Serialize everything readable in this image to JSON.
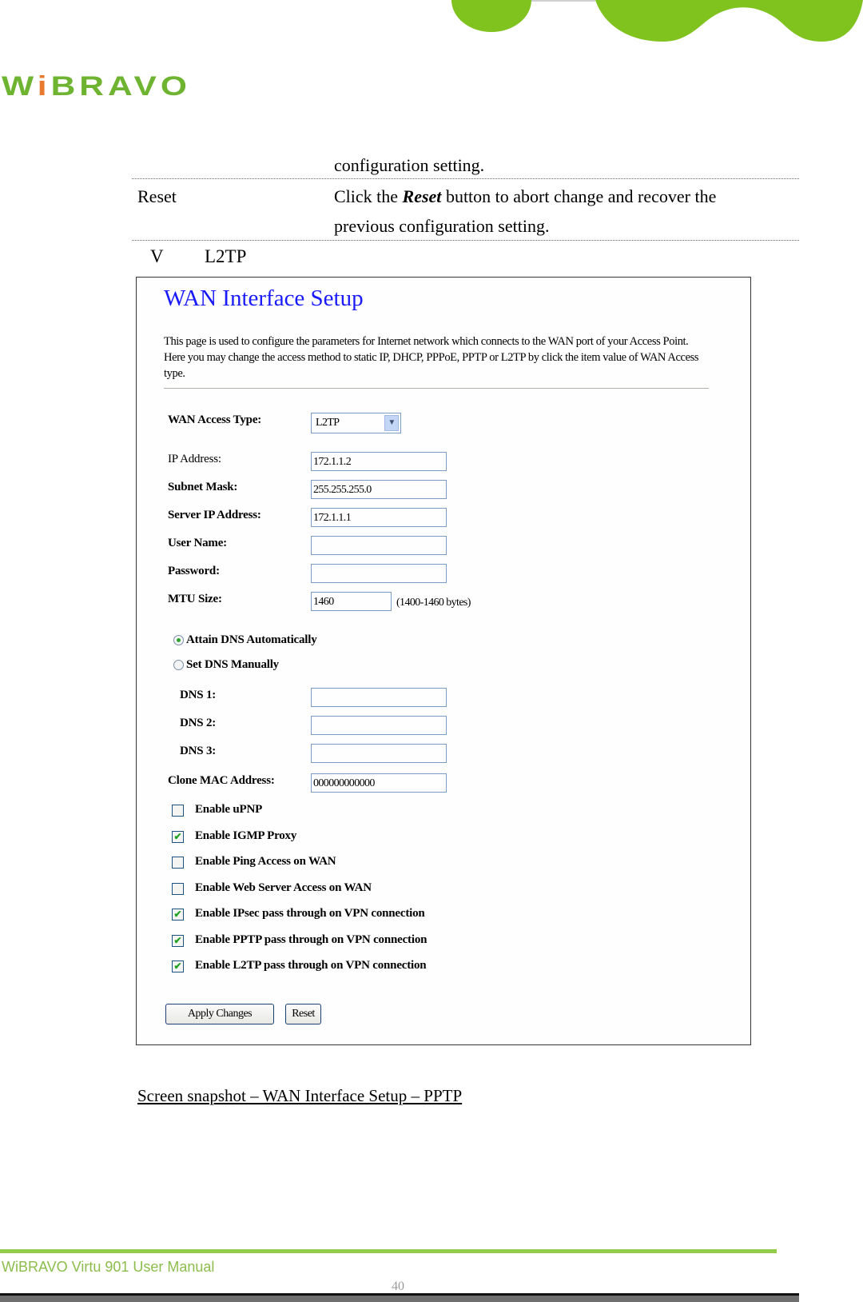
{
  "header": {
    "logo_prefix": "W",
    "logo_i": "i",
    "logo_suffix": "BRAVO",
    "brand_green": "#80c21e",
    "brand_orange": "#e87a2f"
  },
  "doc_table": {
    "prev_row_cont": "configuration setting.",
    "reset_row": {
      "term": "Reset",
      "desc_pre": "Click the ",
      "desc_em": "Reset",
      "desc_post": " button to abort change and recover the",
      "desc_line2": "previous configuration setting."
    }
  },
  "section": {
    "bullet": "V",
    "title": "L2TP"
  },
  "snapshot": {
    "title": "WAN Interface Setup",
    "description": "This page is used to configure the parameters for Internet network which connects to the WAN port of your Access Point. Here you may change the access method to static IP, DHCP, PPPoE, PPTP or L2TP by click the item value of WAN Access type.",
    "wan_access_type": {
      "label": "WAN Access Type:",
      "value": "L2TP"
    },
    "fields": [
      {
        "label": "IP Address:",
        "value": "172.1.1.2"
      },
      {
        "label": "Subnet Mask:",
        "value": "255.255.255.0"
      },
      {
        "label": "Server IP Address:",
        "value": "172.1.1.1"
      },
      {
        "label": "User Name:",
        "value": ""
      },
      {
        "label": "Password:",
        "value": ""
      }
    ],
    "mtu": {
      "label": "MTU Size:",
      "value": "1460",
      "hint": "(1400-1460 bytes)"
    },
    "dns_mode": [
      {
        "label": "Attain DNS Automatically",
        "selected": true
      },
      {
        "label": "Set DNS Manually",
        "selected": false
      }
    ],
    "dns": [
      {
        "label": "DNS 1:",
        "value": ""
      },
      {
        "label": "DNS 2:",
        "value": ""
      },
      {
        "label": "DNS 3:",
        "value": ""
      }
    ],
    "clone_mac": {
      "label": "Clone MAC Address:",
      "value": "000000000000"
    },
    "options": [
      {
        "label": "Enable uPNP",
        "checked": false
      },
      {
        "label": "Enable IGMP Proxy",
        "checked": true
      },
      {
        "label": "Enable Ping Access on WAN",
        "checked": false
      },
      {
        "label": "Enable Web Server Access on WAN",
        "checked": false
      },
      {
        "label": "Enable IPsec pass through on VPN connection",
        "checked": true
      },
      {
        "label": "Enable PPTP pass through on VPN connection",
        "checked": true
      },
      {
        "label": "Enable L2TP pass through on VPN connection",
        "checked": true
      }
    ],
    "buttons": {
      "apply": "Apply Changes",
      "reset": "Reset"
    }
  },
  "caption": "Screen snapshot – WAN Interface Setup – PPTP",
  "footer": {
    "manual_title": "WiBRAVO Virtu 901 User Manual",
    "page_number": "40"
  }
}
